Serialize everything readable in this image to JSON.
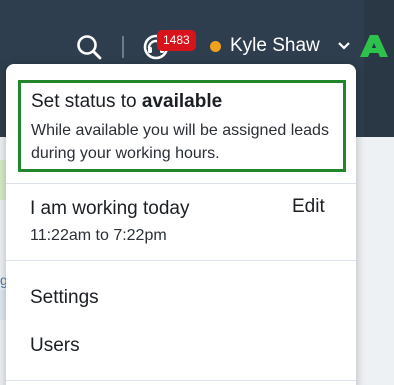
{
  "header": {
    "notification_count": "1483",
    "user_name": "Kyle Shaw",
    "status_color": "#f0a21c",
    "brand_color": "#2dc24b",
    "icons": [
      "search-icon",
      "headset-icon",
      "chevron-down-icon",
      "brand-logo"
    ]
  },
  "menu": {
    "status": {
      "title_prefix": "Set status to ",
      "title_bold": "available",
      "description": "While available you will be assigned leads during your working hours."
    },
    "working": {
      "title": "I am working today",
      "hours": "11:22am to 7:22pm",
      "edit_label": "Edit"
    },
    "items": [
      {
        "label": "Settings"
      },
      {
        "label": "Users"
      }
    ]
  },
  "background": {
    "fragment_text": "g"
  }
}
